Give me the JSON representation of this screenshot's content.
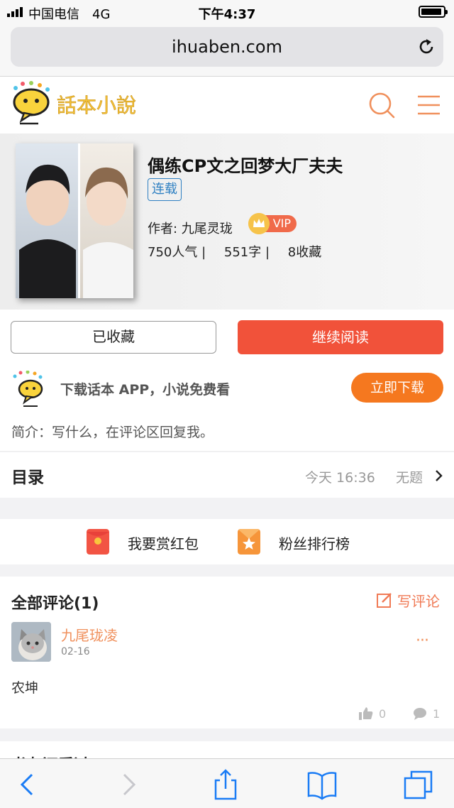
{
  "status_bar": {
    "carrier": "中国电信",
    "network": "4G",
    "time": "下午4:37"
  },
  "browser": {
    "url": "ihuaben.com"
  },
  "site": {
    "logo_text": "話本小說"
  },
  "book": {
    "title": "偶练CP文之回梦大厂夫夫",
    "status_badge": "连载",
    "author_label": "作者: 九尾灵珑",
    "vip_label": "VIP",
    "popularity": "750人气 |",
    "word_count": "551字 |",
    "favorites": "8收藏"
  },
  "actions": {
    "favorited_label": "已收藏",
    "continue_label": "继续阅读"
  },
  "app_promo": {
    "text": "下载话本 APP，小说免费看",
    "button_label": "立即下载"
  },
  "intro": "简介：写什么，在评论区回复我。",
  "toc": {
    "label": "目录",
    "updated": "今天 16:36",
    "latest_chapter": "无题"
  },
  "rewards": {
    "red_packet_label": "我要赏红包",
    "fan_rank_label": "粉丝排行榜"
  },
  "comments": {
    "title": "全部评论(1)",
    "write_label": "写评论",
    "items": [
      {
        "user": "九尾珑凌",
        "date": "02-16",
        "text": "农坤",
        "likes": "0",
        "replies": "1",
        "more": "···"
      }
    ]
  },
  "next_section": {
    "title": "书友还看过"
  },
  "colors": {
    "accent_red": "#f1523a",
    "accent_orange": "#f5781f",
    "link_blue": "#2f80c2",
    "comment_orange": "#f0905c"
  },
  "icons": [
    "signal-icon",
    "battery-icon",
    "reload-icon",
    "logo-icon",
    "search-icon",
    "menu-icon",
    "crown-icon",
    "chevron-right-icon",
    "red-packet-icon",
    "rank-icon",
    "edit-icon",
    "thumb-up-icon",
    "comment-icon",
    "back-icon",
    "forward-icon",
    "share-icon",
    "bookmarks-icon",
    "tabs-icon"
  ]
}
